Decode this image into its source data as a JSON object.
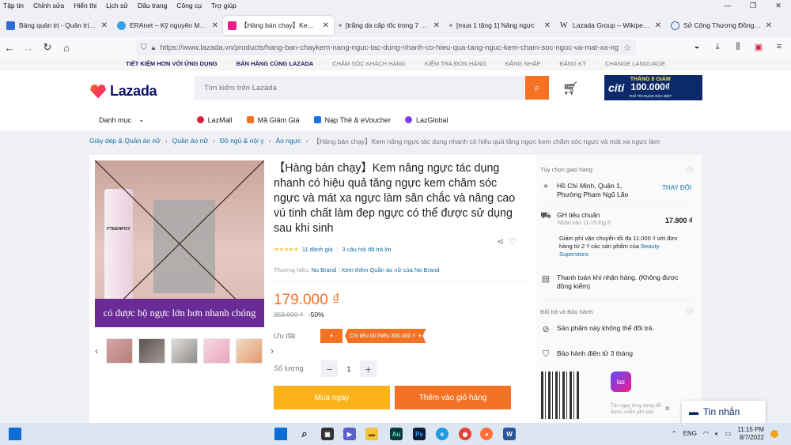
{
  "menubar": {
    "items": [
      "Tập tin",
      "Chỉnh sửa",
      "Hiển thị",
      "Lịch sử",
      "Dấu trang",
      "Công cụ",
      "Trợ giúp"
    ]
  },
  "tabs": [
    {
      "label": "Bảng quản trị - Quản trị website",
      "color": "#2d6bd9"
    },
    {
      "label": "ERAnet – Kỹ nguyên Mạng xã hội",
      "color": "#3aa0e8"
    },
    {
      "label": "【Hàng bán chạy】Kem nâng ngực",
      "color": "#f51a8a"
    },
    {
      "label": "[trắng da cấp tốc trong 7 ngày]",
      "color": "#9e9e9e"
    },
    {
      "label": "[mua 1 tặng 1] Nâng ngực",
      "color": "#9e9e9e"
    },
    {
      "label": "Lazada Group – Wikipedia tiếng",
      "color": "#555555"
    },
    {
      "label": "Sở Công Thương Đồng Nai",
      "color": "#2d6bd9"
    }
  ],
  "browser": {
    "url": "https://www.lazada.vn/products/hang-ban-chaykem-nang-nguc-tac-dung-nhanh-co-hieu-qua-tang-nguc-kem-cham-soc-nguc-va-mat-xa-ngu..."
  },
  "toplinks": [
    "TIẾT KIỆM HƠN VỚI ỨNG DỤNG",
    "BÁN HÀNG CÙNG LAZADA",
    "CHĂM SÓC KHÁCH HÀNG",
    "KIỂM TRA ĐƠN HÀNG",
    "ĐĂNG NHẬP",
    "ĐĂNG KÝ",
    "CHANGE LANGUAGE"
  ],
  "header": {
    "logo": "Lazada",
    "search_placeholder": "Tìm kiếm trên Lazada",
    "citi_brand": "citi",
    "citi_line1": "THÁNG 8 GIẢM",
    "citi_amount": "100.000₫",
    "citi_note": "THẺ TÍN DỤNG ĐẶC BIỆT"
  },
  "catnav": {
    "danhmuc": "Danh mục",
    "items": [
      {
        "label": "LazMall",
        "color": "#d9243b"
      },
      {
        "label": "Mã Giảm Giá",
        "color": "#f57224"
      },
      {
        "label": "Nạp Thẻ & eVoucher",
        "color": "#1a73e8"
      },
      {
        "label": "LazGlobal",
        "color": "#7b3ff2"
      }
    ]
  },
  "breadcrumb": [
    "Giày dép & Quần áo nữ",
    "Quần áo nữ",
    "Đồ ngủ & nội y",
    "Áo ngực",
    "【Hàng bán chạy】Kem nâng ngực tác dụng nhanh có hiệu quả tăng ngực kem chăm sóc ngực và mát xa ngực làm"
  ],
  "product": {
    "title": "【Hàng bán chạy】Kem nâng ngực tác dụng nhanh có hiệu quả tăng ngực kem chăm sóc ngực và mát xa ngực làm săn chắc và nâng cao vú tinh chất làm đẹp ngực có thể được sử dụng sau khi sinh",
    "image_brand": "FTEENPOY",
    "image_banner": "có được bộ ngực lớn hơn nhanh chóng",
    "stars": "★★★★★",
    "ratings": "11 đánh giá",
    "questions": "3 câu hỏi đã trả lời",
    "brand_label": "Thương hiệu:",
    "brand_value": "No Brand",
    "brand_more": "Xem thêm Quần áo nữ của No Brand",
    "price": "179.000 ₫",
    "old_price": "358.000 ₫",
    "discount": "-50%",
    "uudai_label": "Ưu đãi",
    "voucher": "Chi tiêu tối thiểu 300.000 ₫",
    "qty_label": "Số lượng",
    "qty": "1",
    "buy_now": "Mua ngay",
    "add_to_cart": "Thêm vào giỏ hàng"
  },
  "delivery": {
    "title": "Tùy chọn giao hàng",
    "address": "Hồ Chí Minh, Quận 1, Phường Phạm Ngũ Lão",
    "change": "THAY ĐỔI",
    "ship_type": "GH tiêu chuẩn",
    "ship_time": "Nhận vào 11-15 thg 8",
    "ship_fee": "17.800 ₫",
    "free_ship_note": "Giảm phí vận chuyển tối đa 11.000 ₫ với đơn hàng từ 2 ₫ các sản phẩm của",
    "free_ship_shop": "Beauty Superstore.",
    "cod": "Thanh toán khi nhận hàng. (Không được đồng kiểm)",
    "return_title": "Đổi trả và Bảo hành",
    "no_return": "Sản phẩm này không thể đổi trả.",
    "warranty": "Bảo hành điện tử 3 tháng",
    "app_logo": "laz",
    "app_note": "Tải ngay ứng dụng để được miễn phí vận"
  },
  "chat": {
    "label": "Tin nhắn"
  },
  "taskbar": {
    "lang": "ENG",
    "time": "11:15 PM",
    "date": "8/7/2022",
    "icons": [
      {
        "name": "windows",
        "color": "#0f6cd6"
      },
      {
        "name": "search",
        "color": "#222222"
      },
      {
        "name": "task-view",
        "color": "#333333"
      },
      {
        "name": "explorer",
        "color": "#f3c33c"
      },
      {
        "name": "teams",
        "color": "#5b5fc7"
      },
      {
        "name": "audition",
        "color": "#0b3a3a"
      },
      {
        "name": "photoshop",
        "color": "#0b1e3a"
      },
      {
        "name": "edge",
        "color": "#1f9ae0"
      },
      {
        "name": "chrome",
        "color": "#e34133"
      },
      {
        "name": "firefox",
        "color": "#ff7139"
      },
      {
        "name": "word",
        "color": "#2b579a"
      }
    ]
  }
}
